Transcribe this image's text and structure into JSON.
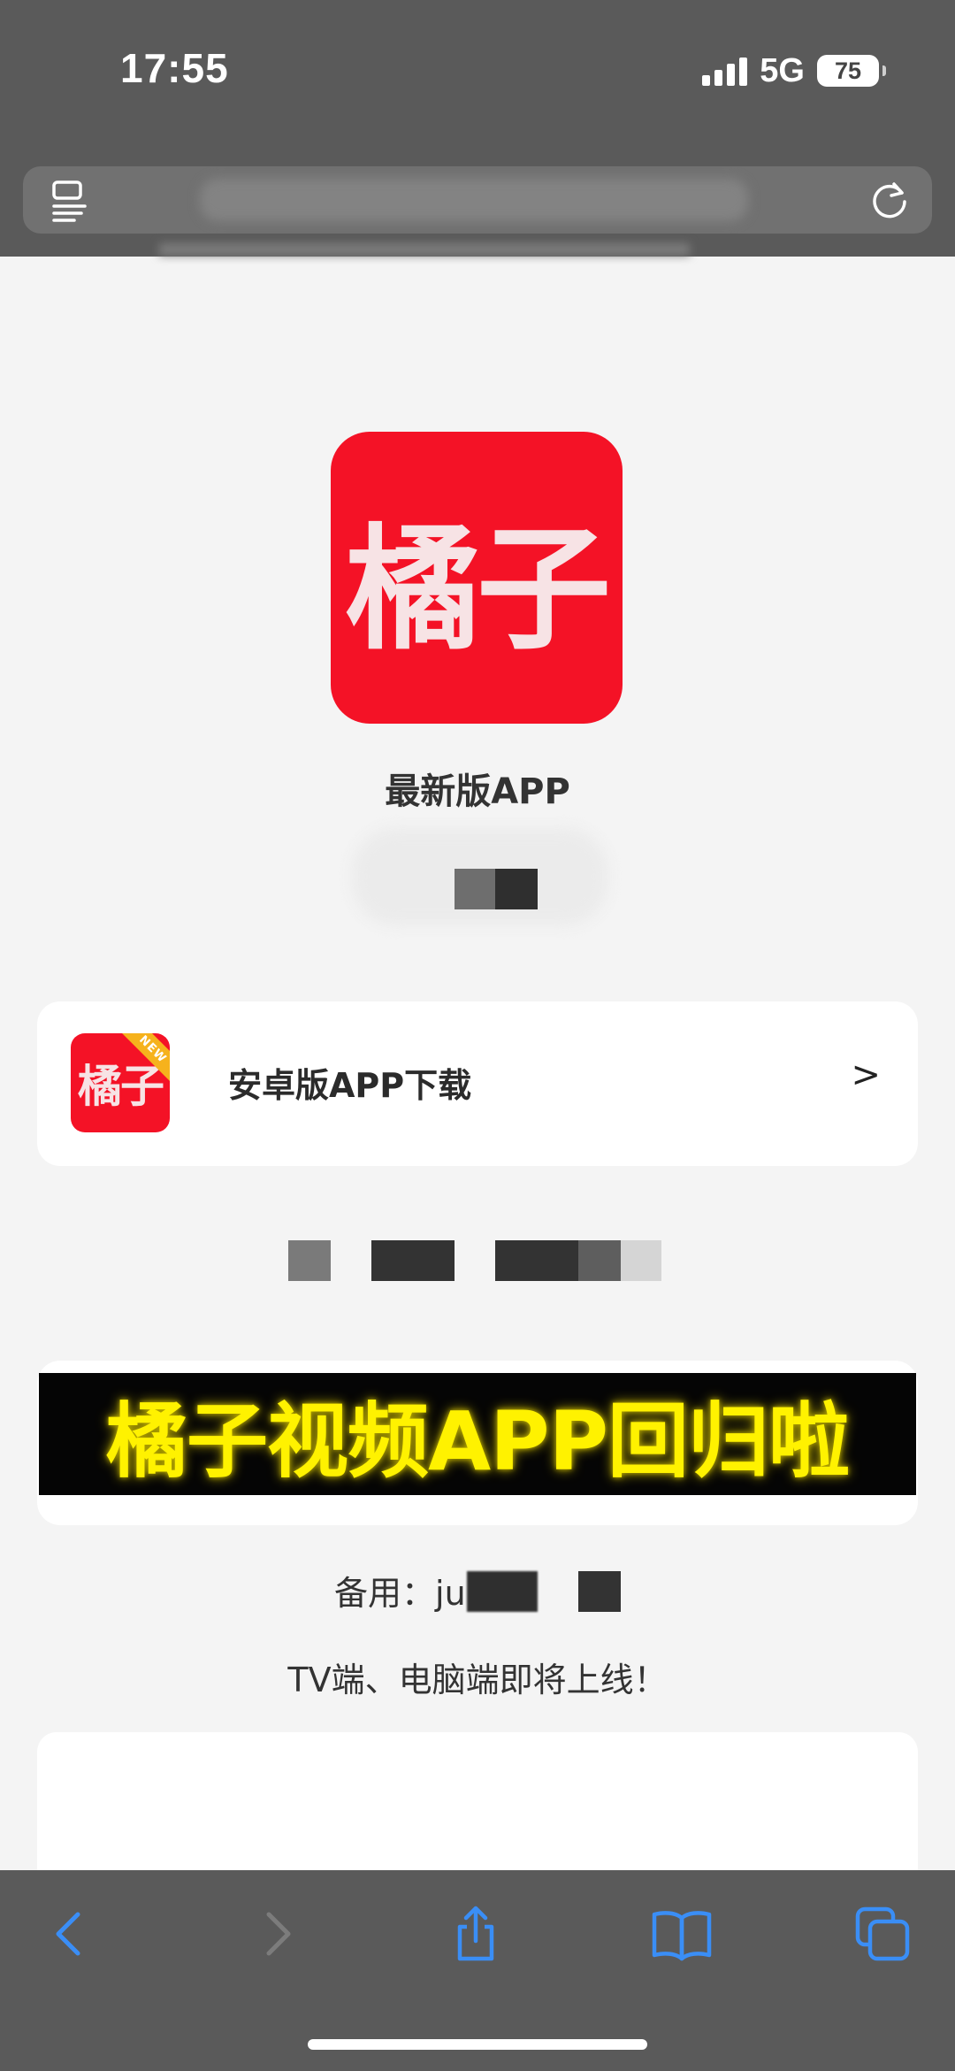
{
  "status_bar": {
    "time": "17:55",
    "network": "5G",
    "battery": "75"
  },
  "browser": {
    "tabs_icon": "tabs-icon",
    "reload_icon": "reload-icon"
  },
  "app": {
    "logo_text": "橘子",
    "title": "最新版APP"
  },
  "download": {
    "logo_text": "橘子",
    "badge": "NEW",
    "label": "安卓版APP下载",
    "arrow": ">"
  },
  "banner": {
    "text": "橘子视频APP回归啦"
  },
  "backup": {
    "label": "备用：",
    "value_visible": "ju"
  },
  "notice": "TV端、电脑端即将上线！",
  "toolbar": {
    "back_icon": "chevron-left-icon",
    "forward_icon": "chevron-right-icon",
    "share_icon": "share-icon",
    "bookmarks_icon": "book-icon",
    "tabs_icon": "tabs-icon"
  },
  "colors": {
    "brand_red": "#f41226",
    "banner_yellow": "#fff200",
    "toolbar_blue": "#3a8ef6",
    "chrome_gray": "#5a5a5a"
  }
}
